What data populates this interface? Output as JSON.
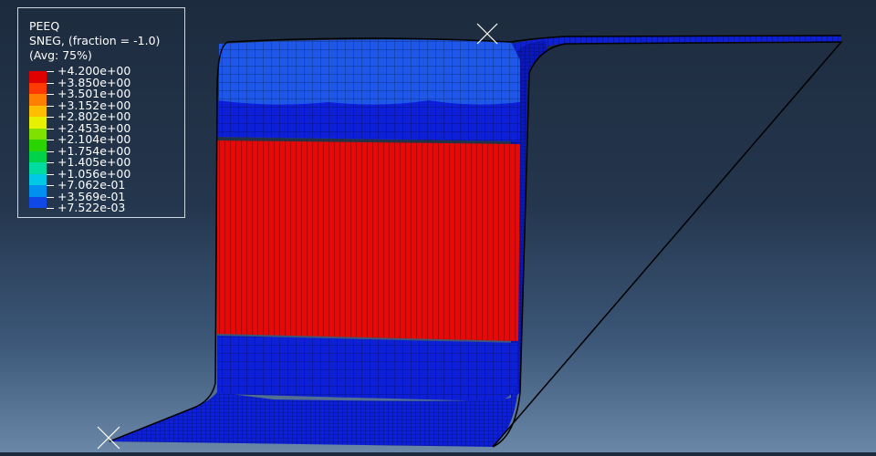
{
  "legend": {
    "variable": "PEEQ",
    "section": "SNEG, (fraction = -1.0)",
    "averaging": "(Avg: 75%)",
    "levels": [
      {
        "label": "+4.200e+00",
        "color": "#e00000"
      },
      {
        "label": "+3.850e+00",
        "color": "#ff3a00"
      },
      {
        "label": "+3.501e+00",
        "color": "#ff8000"
      },
      {
        "label": "+3.152e+00",
        "color": "#ffbf00"
      },
      {
        "label": "+2.802e+00",
        "color": "#e6f000"
      },
      {
        "label": "+2.453e+00",
        "color": "#80e000"
      },
      {
        "label": "+2.104e+00",
        "color": "#2ad400"
      },
      {
        "label": "+1.754e+00",
        "color": "#00d24a"
      },
      {
        "label": "+1.405e+00",
        "color": "#00dca0"
      },
      {
        "label": "+1.056e+00",
        "color": "#00c8e6"
      },
      {
        "label": "+7.062e-01",
        "color": "#0090f0"
      },
      {
        "label": "+3.569e-01",
        "color": "#1048e8"
      },
      {
        "label": "+7.522e-03",
        "color": "#0a10d0"
      }
    ]
  },
  "colors": {
    "high_strain": "#e80808",
    "low_strain": "#0d20d8",
    "flange_upper": "#1f58e8",
    "background_top": "#1d2b3e",
    "background_bottom": "#6a87a8"
  }
}
